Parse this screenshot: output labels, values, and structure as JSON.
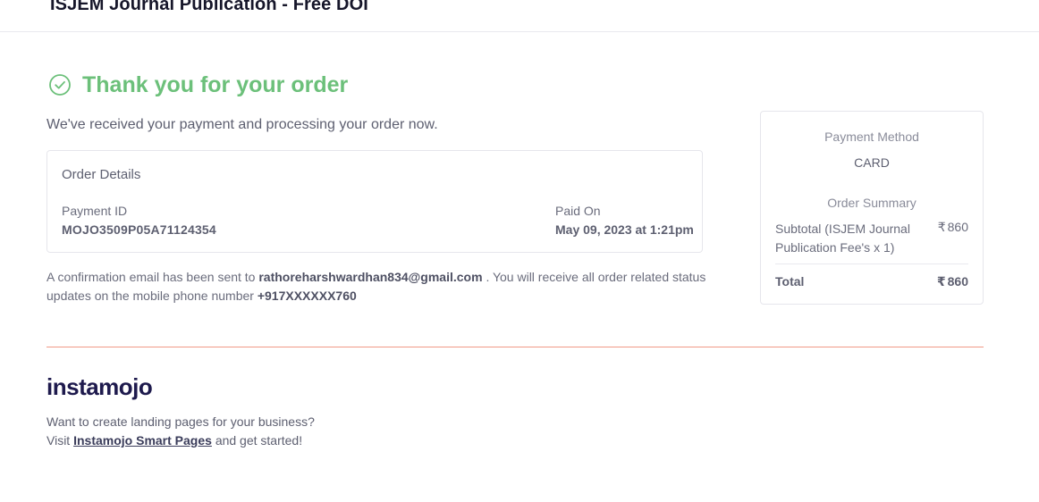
{
  "header": {
    "title": "ISJEM Journal Publication - Free DOI"
  },
  "status": {
    "title": "Thank you for your order",
    "subtitle": "We've received your payment and processing your order now.",
    "accent_color": "#6cc07a"
  },
  "order_details": {
    "heading": "Order Details",
    "payment_id_label": "Payment ID",
    "payment_id_value": "MOJO3509P05A71124354",
    "paid_on_label": "Paid On",
    "paid_on_value": "May 09, 2023 at 1:21pm"
  },
  "confirmation": {
    "prefix": "A confirmation email has been sent to",
    "email": "rathoreharshwardhan834@gmail.com",
    "middle": ". You will receive all order related status updates on the mobile phone number",
    "phone": "+917XXXXXX760"
  },
  "summary": {
    "payment_method_label": "Payment Method",
    "payment_method_value": "CARD",
    "order_summary_label": "Order Summary",
    "subtotal_label": "Subtotal (ISJEM Journal Publication Fee's x 1)",
    "subtotal_amount": "860",
    "total_label": "Total",
    "total_amount": "860",
    "currency_symbol": "₹"
  },
  "footer": {
    "logo_text": "instamojo",
    "promo_line1": "Want to create landing pages for your business?",
    "promo_visit": "Visit",
    "promo_link": "Instamojo Smart Pages",
    "promo_suffix": "and get started!",
    "rule_color": "#f09a86"
  }
}
